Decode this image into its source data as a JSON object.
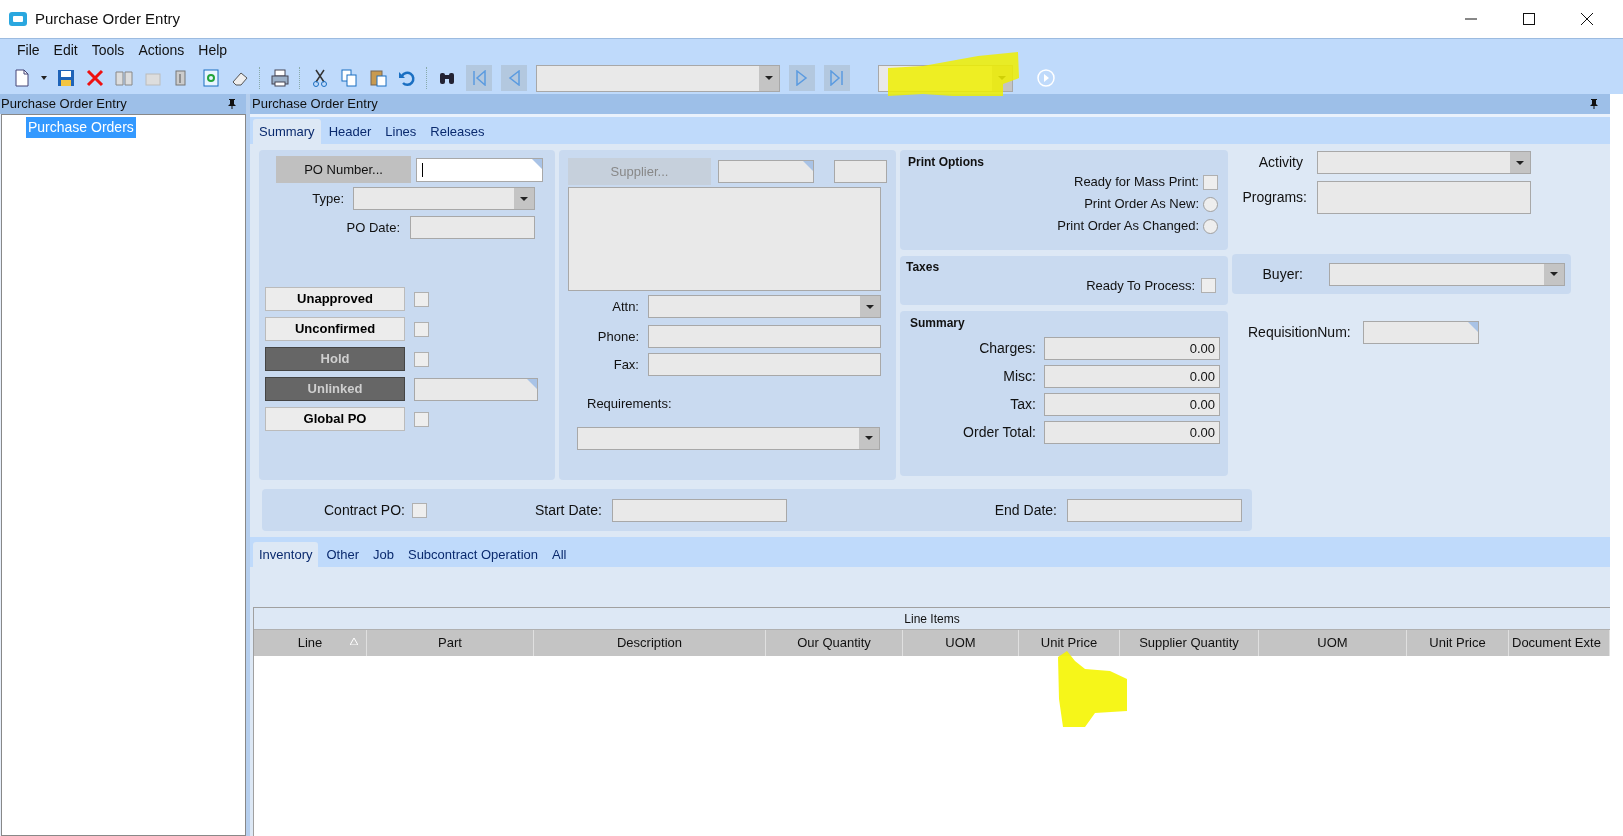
{
  "window": {
    "title": "Purchase Order Entry"
  },
  "menu": [
    "File",
    "Edit",
    "Tools",
    "Actions",
    "Help"
  ],
  "left_panel": {
    "title": "Purchase Order Entry",
    "tree": [
      {
        "label": "Purchase Orders",
        "selected": true
      }
    ]
  },
  "main_panel": {
    "title": "Purchase Order Entry",
    "tabs": [
      {
        "label": "Summary",
        "selected": true
      },
      {
        "label": "Header",
        "selected": false
      },
      {
        "label": "Lines",
        "selected": false
      },
      {
        "label": "Releases",
        "selected": false
      }
    ],
    "po_number_button": "PO Number...",
    "type_label": "Type:",
    "po_date_label": "PO Date:",
    "status_flags": [
      {
        "label": "Unapproved",
        "kind": "checkbox",
        "dimmed": false,
        "checked": false
      },
      {
        "label": "Unconfirmed",
        "kind": "checkbox",
        "dimmed": false,
        "checked": false
      },
      {
        "label": "Hold",
        "kind": "checkbox",
        "dimmed": true,
        "checked": false
      },
      {
        "label": "Unlinked",
        "kind": "field",
        "dimmed": true
      },
      {
        "label": "Global PO",
        "kind": "checkbox",
        "dimmed": false,
        "checked": false
      }
    ],
    "supplier_button": "Supplier...",
    "attn_label": "Attn:",
    "phone_label": "Phone:",
    "fax_label": "Fax:",
    "requirements_label": "Requirements:",
    "print_options": {
      "title": "Print Options",
      "items": [
        {
          "label": "Ready for Mass Print:",
          "kind": "checkbox",
          "checked": false
        },
        {
          "label": "Print Order As New:",
          "kind": "radio",
          "selected": false
        },
        {
          "label": "Print Order As Changed:",
          "kind": "radio",
          "selected": false
        }
      ]
    },
    "taxes": {
      "title": "Taxes",
      "ready_label": "Ready To Process:",
      "ready_checked": false
    },
    "summary": {
      "title": "Summary",
      "rows": [
        {
          "label": "Charges:",
          "value": "0.00"
        },
        {
          "label": "Misc:",
          "value": "0.00"
        },
        {
          "label": "Tax:",
          "value": "0.00"
        },
        {
          "label": "Order Total:",
          "value": "0.00"
        }
      ]
    },
    "activity_label": "Activity",
    "programs_label": "Programs:",
    "buyer_label": "Buyer:",
    "requisition_label": "RequisitionNum:",
    "contract_label": "Contract PO:",
    "contract_checked": false,
    "start_date_label": "Start Date:",
    "end_date_label": "End Date:",
    "line_tabs": [
      {
        "label": "Inventory",
        "selected": true
      },
      {
        "label": "Other",
        "selected": false
      },
      {
        "label": "Job",
        "selected": false
      },
      {
        "label": "Subcontract Operation",
        "selected": false
      },
      {
        "label": "All",
        "selected": false
      }
    ],
    "grid": {
      "title": "Line Items",
      "columns": [
        {
          "label": "Line",
          "sorted": true
        },
        {
          "label": "Part",
          "sorted": false
        },
        {
          "label": "Description",
          "sorted": false
        },
        {
          "label": "Our Quantity",
          "sorted": false
        },
        {
          "label": "UOM",
          "sorted": false
        },
        {
          "label": "Unit Price",
          "sorted": false
        },
        {
          "label": "Supplier Quantity",
          "sorted": false
        },
        {
          "label": "UOM",
          "sorted": false
        },
        {
          "label": "Unit Price",
          "sorted": false
        },
        {
          "label": "Document Exte",
          "sorted": false
        }
      ]
    }
  }
}
